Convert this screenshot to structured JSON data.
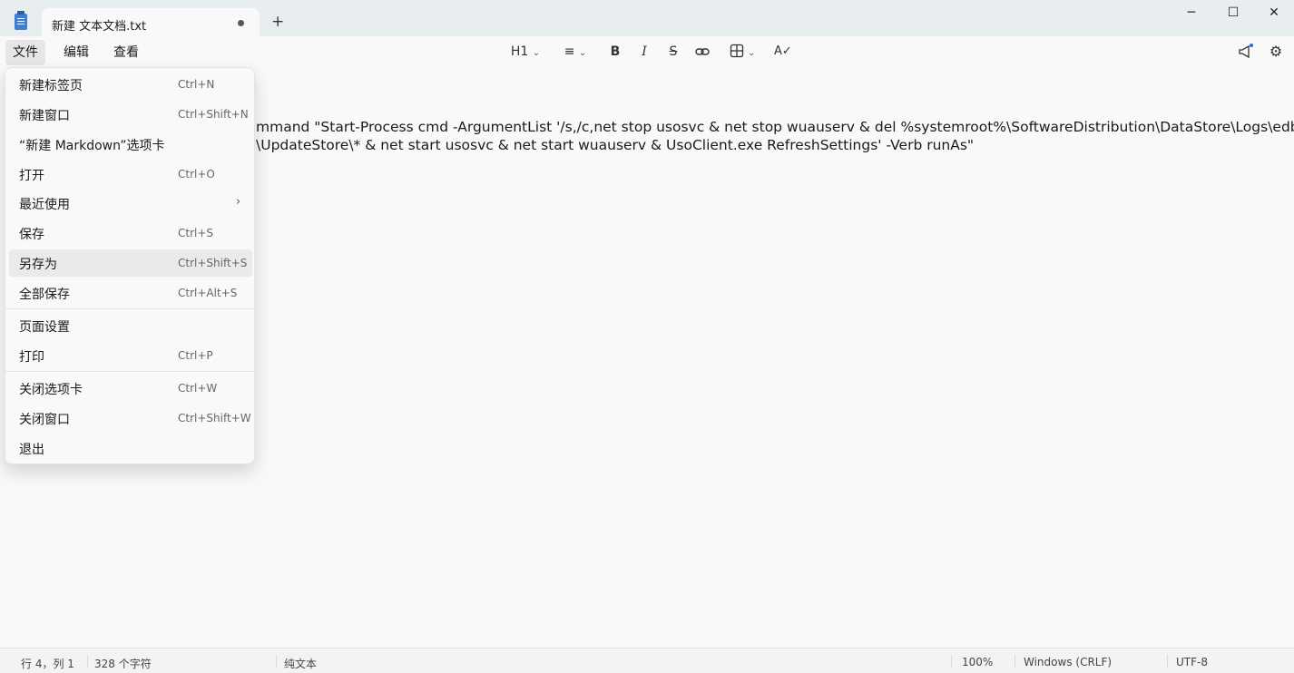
{
  "titlebar": {
    "tab_title": "新建 文本文档.txt",
    "new_tab": "+",
    "min": "─",
    "max": "☐",
    "close": "✕"
  },
  "menubar": {
    "file": "文件",
    "edit": "编辑",
    "view": "查看"
  },
  "toolbar": {
    "heading": "H1",
    "bold": "B",
    "italic": "I",
    "strike": "S",
    "link_icon": "link-icon",
    "table_icon": "table-icon",
    "spellcheck_icon": "spellcheck-icon"
  },
  "editor": {
    "line1": "mmand \"Start-Process cmd -ArgumentList '/s,/c,net stop usosvc & net stop wuauserv & del %systemroot%\\SoftwareDistribution\\DataStore\\Logs\\edb.log &",
    "line2": "\\UpdateStore\\* & net start usosvc & net start wuauserv & UsoClient.exe RefreshSettings' -Verb runAs\""
  },
  "file_menu": {
    "items": [
      {
        "label": "新建标签页",
        "shortcut": "Ctrl+N"
      },
      {
        "label": "新建窗口",
        "shortcut": "Ctrl+Shift+N"
      },
      {
        "label": "“新建 Markdown”选项卡",
        "shortcut": ""
      },
      {
        "label": "打开",
        "shortcut": "Ctrl+O"
      },
      {
        "label": "最近使用",
        "shortcut": "",
        "submenu_arrow": "›"
      },
      {
        "label": "保存",
        "shortcut": "Ctrl+S"
      },
      {
        "label": "另存为",
        "shortcut": "Ctrl+Shift+S"
      },
      {
        "label": "全部保存",
        "shortcut": "Ctrl+Alt+S"
      },
      {
        "label": "页面设置",
        "shortcut": ""
      },
      {
        "label": "打印",
        "shortcut": "Ctrl+P"
      },
      {
        "label": "关闭选项卡",
        "shortcut": "Ctrl+W"
      },
      {
        "label": "关闭窗口",
        "shortcut": "Ctrl+Shift+W"
      },
      {
        "label": "退出",
        "shortcut": ""
      }
    ]
  },
  "statusbar": {
    "position": "行 4，列 1",
    "chars": "328 个字符",
    "format": "纯文本",
    "zoom": "100%",
    "line_ending": "Windows (CRLF)",
    "encoding": "UTF-8"
  }
}
